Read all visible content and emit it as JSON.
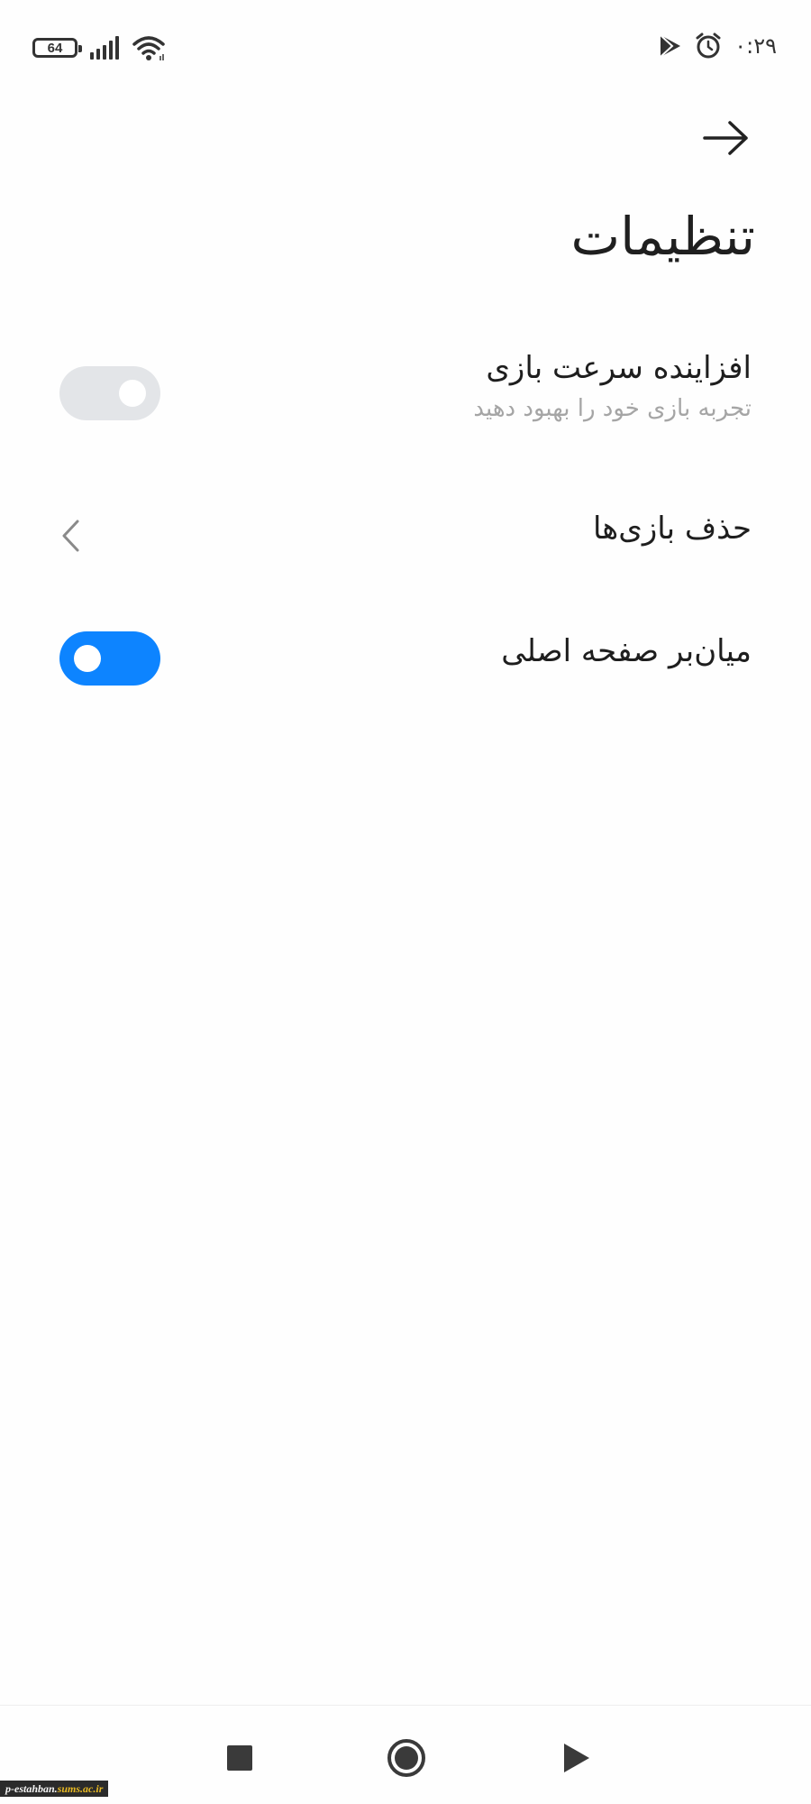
{
  "status_bar": {
    "battery_level": "64",
    "time": "۰:۲۹",
    "icons": [
      "battery-icon",
      "cellular-signal-icon",
      "wifi-icon",
      "play-store-icon",
      "alarm-icon"
    ]
  },
  "header": {
    "back_icon": "arrow-right-icon",
    "title": "تنظیمات"
  },
  "settings": {
    "game_turbo": {
      "label": "افزاینده سرعت بازی",
      "subtitle": "تجربه بازی خود را بهبود دهید",
      "enabled": false
    },
    "remove_games": {
      "label": "حذف بازی‌ها",
      "icon": "chevron-left-icon"
    },
    "home_shortcut": {
      "label": "میان‌بر صفحه اصلی",
      "enabled": true
    }
  },
  "colors": {
    "accent": "#0d84ff",
    "toggle_off": "#e3e5e8",
    "subtitle": "#a5a5a5"
  },
  "nav_bar": {
    "icons": [
      "recents-square-icon",
      "home-circle-icon",
      "back-triangle-icon"
    ]
  },
  "watermark": {
    "prefix": "p-estahban.",
    "suffix": "sums.ac.ir"
  }
}
